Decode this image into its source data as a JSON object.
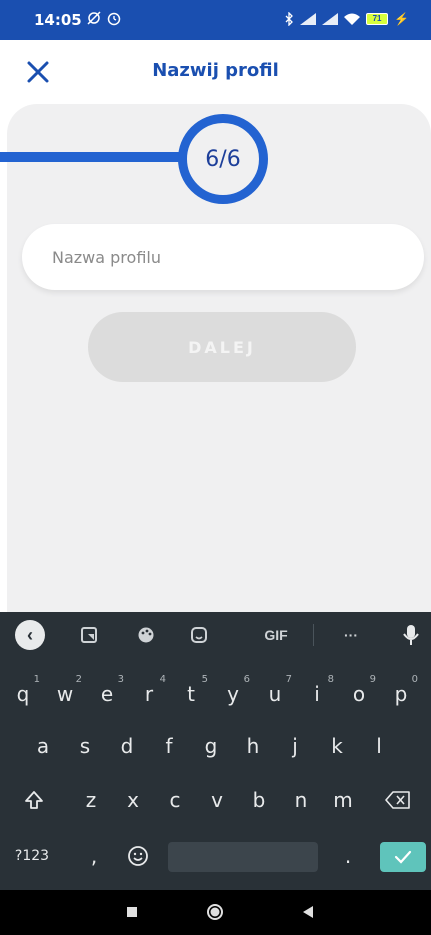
{
  "status_bar": {
    "time": "14:05",
    "left_icons": [
      "sync-off-icon",
      "alarm-icon"
    ],
    "right_icons": [
      "bluetooth-icon",
      "signal-icon",
      "signal-icon",
      "wifi-icon"
    ],
    "battery": "71"
  },
  "header": {
    "close_icon": "close-icon",
    "title": "Nazwij profil"
  },
  "progress": {
    "label": "6/6",
    "current": 6,
    "total": 6
  },
  "form": {
    "name_placeholder": "Nazwa profilu",
    "name_value": ""
  },
  "next_button": {
    "label": "DALEJ"
  },
  "keyboard": {
    "toolbar": [
      "back-icon",
      "sticker-icon",
      "palette-icon",
      "emoji-sticker-icon",
      "GIF",
      "···",
      "mic-icon"
    ],
    "row1": [
      {
        "k": "q",
        "n": "1"
      },
      {
        "k": "w",
        "n": "2"
      },
      {
        "k": "e",
        "n": "3"
      },
      {
        "k": "r",
        "n": "4"
      },
      {
        "k": "t",
        "n": "5"
      },
      {
        "k": "y",
        "n": "6"
      },
      {
        "k": "u",
        "n": "7"
      },
      {
        "k": "i",
        "n": "8"
      },
      {
        "k": "o",
        "n": "9"
      },
      {
        "k": "p",
        "n": "0"
      }
    ],
    "row2": [
      "a",
      "s",
      "d",
      "f",
      "g",
      "h",
      "j",
      "k",
      "l"
    ],
    "row3": [
      "z",
      "x",
      "c",
      "v",
      "b",
      "n",
      "m"
    ],
    "row4": {
      "numbers": "?123",
      "comma": ",",
      "period": "."
    }
  },
  "colors": {
    "brand_blue": "#2363d1",
    "status_bar": "#1a4fb0",
    "keyboard_bg": "#293137",
    "enter_key": "#5fc4bb"
  }
}
